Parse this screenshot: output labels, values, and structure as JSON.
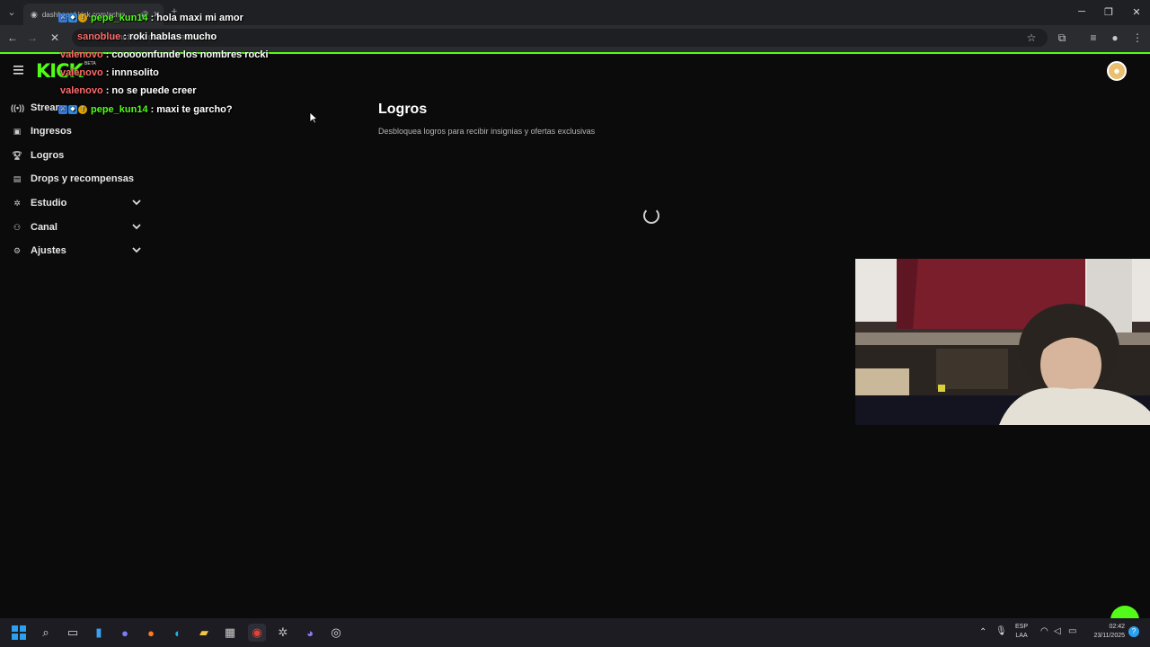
{
  "browser": {
    "tab_title": "dashboard.kick.com/achie...",
    "address_text": "dashboard.kick.com/achievements"
  },
  "overlay_chat": [
    {
      "badges": [
        "mod",
        "shield",
        "gift"
      ],
      "user": "pepe_kun14",
      "user_color": "#53fc18",
      "message": "hola maxi mi amor"
    },
    {
      "badges": [],
      "user": "sanoblue",
      "user_color": "#ff6b6b",
      "message": "roki hablas mucho"
    },
    {
      "badges": [],
      "user": "valenovo",
      "user_color": "#ff6b6b",
      "message": "cooooonfunde los nombres rocki"
    },
    {
      "badges": [],
      "user": "valenovo",
      "user_color": "#ff6b6b",
      "message": "innnsolito"
    },
    {
      "badges": [],
      "user": "valenovo",
      "user_color": "#ff6b6b",
      "message": "no se puede creer"
    },
    {
      "badges": [
        "mod",
        "shield",
        "gift"
      ],
      "user": "pepe_kun14",
      "user_color": "#53fc18",
      "message": "maxi te garcho?"
    }
  ],
  "app": {
    "logo": "KICK",
    "logo_tag": "BETA",
    "accent": "#53fc18"
  },
  "sidebar": {
    "items": [
      {
        "label": "Stream",
        "icon": "broadcast-icon",
        "expandable": false
      },
      {
        "label": "Ingresos",
        "icon": "wallet-icon",
        "expandable": false
      },
      {
        "label": "Logros",
        "icon": "trophy-icon",
        "expandable": false
      },
      {
        "label": "Drops y recompensas",
        "icon": "gift-icon",
        "expandable": false
      },
      {
        "label": "Estudio",
        "icon": "studio-icon",
        "expandable": true
      },
      {
        "label": "Canal",
        "icon": "channel-icon",
        "expandable": true
      },
      {
        "label": "Ajustes",
        "icon": "gear-icon",
        "expandable": true
      }
    ]
  },
  "main": {
    "title": "Logros",
    "subtitle": "Desbloquea logros para recibir insignias y ofertas exclusivas"
  },
  "tray": {
    "lang_top": "ESP",
    "lang_bottom": "LAA",
    "time": "02:42",
    "date": "23/11/2025"
  }
}
